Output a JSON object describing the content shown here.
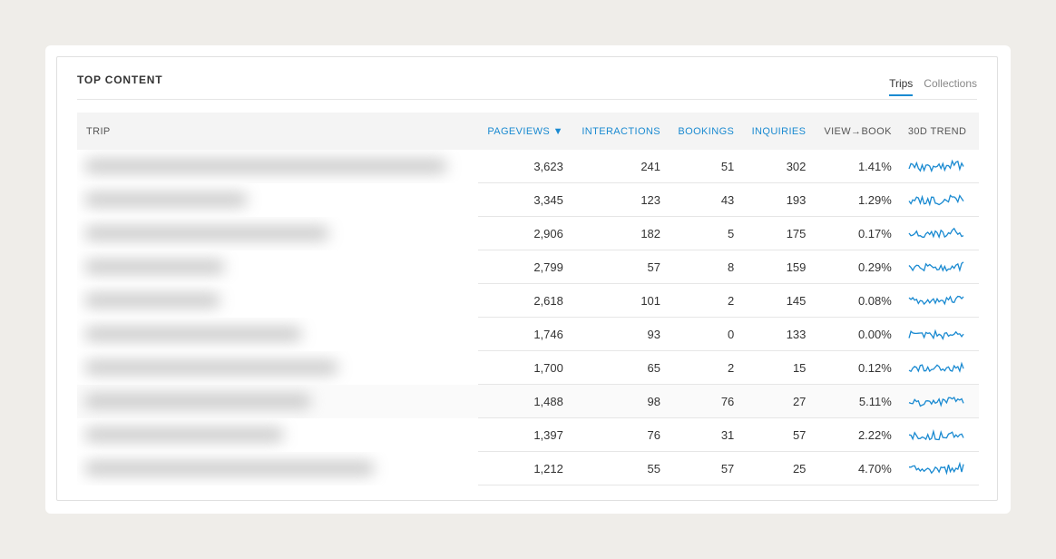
{
  "panel": {
    "title": "TOP CONTENT",
    "tabs": [
      {
        "label": "Trips",
        "active": true
      },
      {
        "label": "Collections",
        "active": false
      }
    ]
  },
  "table": {
    "headers": {
      "trip": "TRIP",
      "pageviews": "PAGEVIEWS ▼",
      "interactions": "INTERACTIONS",
      "bookings": "BOOKINGS",
      "inquiries": "INQUIRIES",
      "view_book": "VIEW→BOOK",
      "trend": "30D TREND"
    },
    "rows": [
      {
        "pageviews": "3,623",
        "interactions": "241",
        "bookings": "51",
        "inquiries": "302",
        "view_book": "1.41%"
      },
      {
        "pageviews": "3,345",
        "interactions": "123",
        "bookings": "43",
        "inquiries": "193",
        "view_book": "1.29%"
      },
      {
        "pageviews": "2,906",
        "interactions": "182",
        "bookings": "5",
        "inquiries": "175",
        "view_book": "0.17%"
      },
      {
        "pageviews": "2,799",
        "interactions": "57",
        "bookings": "8",
        "inquiries": "159",
        "view_book": "0.29%"
      },
      {
        "pageviews": "2,618",
        "interactions": "101",
        "bookings": "2",
        "inquiries": "145",
        "view_book": "0.08%"
      },
      {
        "pageviews": "1,746",
        "interactions": "93",
        "bookings": "0",
        "inquiries": "133",
        "view_book": "0.00%"
      },
      {
        "pageviews": "1,700",
        "interactions": "65",
        "bookings": "2",
        "inquiries": "15",
        "view_book": "0.12%"
      },
      {
        "pageviews": "1,488",
        "interactions": "98",
        "bookings": "76",
        "inquiries": "27",
        "view_book": "5.11%"
      },
      {
        "pageviews": "1,397",
        "interactions": "76",
        "bookings": "31",
        "inquiries": "57",
        "view_book": "2.22%"
      },
      {
        "pageviews": "1,212",
        "interactions": "55",
        "bookings": "57",
        "inquiries": "25",
        "view_book": "4.70%"
      }
    ]
  },
  "colors": {
    "accent": "#1a8ad1",
    "sparkline": "#1a8ad1"
  }
}
